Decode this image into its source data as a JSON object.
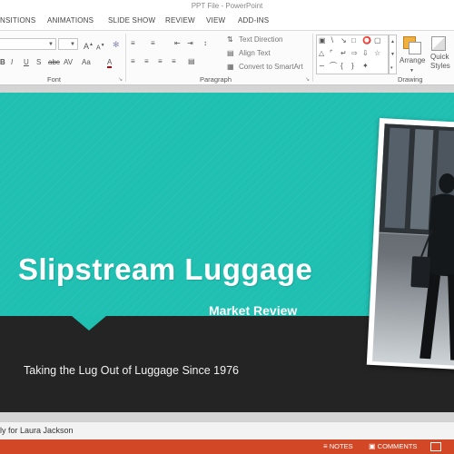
{
  "window": {
    "title": "PPT File - PowerPoint"
  },
  "tabs": [
    "NSITIONS",
    "ANIMATIONS",
    "SLIDE SHOW",
    "REVIEW",
    "VIEW",
    "ADD-INS"
  ],
  "ribbon": {
    "font_size_inc": "A",
    "font_size_dec": "A",
    "bold": "B",
    "underline": "U",
    "strikethrough": "S",
    "strike_abc": "abc",
    "char_spacing": "AV",
    "change_case": "Aa",
    "font_color": "A",
    "text_direction": "Text Direction",
    "align_text": "Align Text",
    "convert_smartart": "Convert to SmartArt",
    "arrange": "Arrange",
    "quick_styles_1": "Quick",
    "quick_styles_2": "Styles",
    "groups": {
      "font": "Font",
      "paragraph": "Paragraph",
      "drawing": "Drawing"
    }
  },
  "slide": {
    "title": "Slipstream Luggage",
    "subtitle": "Market Review",
    "tagline": "Taking the Lug Out of Luggage Since 1976",
    "colors": {
      "teal": "#1fbfb1",
      "dark": "#242424"
    }
  },
  "comment_strip": {
    "text": "ly for Laura Jackson"
  },
  "statusbar": {
    "notes": "NOTES",
    "comments": "COMMENTS"
  },
  "colors": {
    "accent": "#d24726"
  }
}
